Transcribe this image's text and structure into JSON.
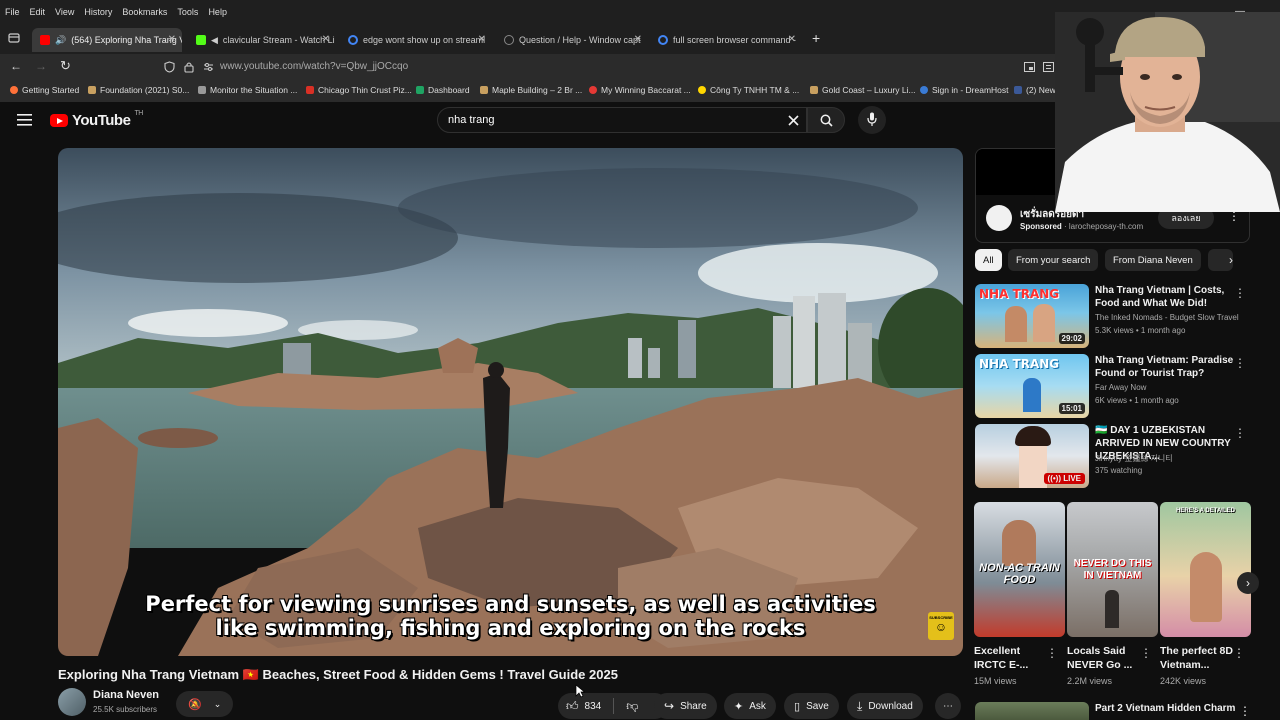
{
  "menubar": [
    "File",
    "Edit",
    "View",
    "History",
    "Bookmarks",
    "Tools",
    "Help"
  ],
  "tabs": [
    {
      "label": "(564) Exploring Nha Trang V",
      "color": "#ff0000"
    },
    {
      "label": "clavicular Stream - Watch Li",
      "color": "#53fc18"
    },
    {
      "label": "edge wont show up on streaml",
      "color": "#4285f4"
    },
    {
      "label": "Question / Help - Window capt",
      "color": "#888888"
    },
    {
      "label": "full screen browser command -",
      "color": "#4285f4"
    }
  ],
  "address": {
    "url": "www.youtube.com/watch?v=Qbw_jjOCcqo"
  },
  "bookmarks": [
    {
      "label": "Getting Started",
      "color": "#ff7139"
    },
    {
      "label": "Foundation (2021) S0...",
      "color": "#c8a060"
    },
    {
      "label": "Monitor the Situation ...",
      "color": "#999999"
    },
    {
      "label": "Chicago Thin Crust Piz...",
      "color": "#d93025"
    },
    {
      "label": "Dashboard",
      "color": "#1fa463"
    },
    {
      "label": "Maple Building – 2 Br ...",
      "color": "#c8a060"
    },
    {
      "label": "My Winning Baccarat ...",
      "color": "#e53935"
    },
    {
      "label": "Công Ty TNHH TM & ...",
      "color": "#ffd600"
    },
    {
      "label": "Gold Coast – Luxury Li...",
      "color": "#c8a060"
    },
    {
      "label": "Sign in - DreamHost",
      "color": "#3a7bd5"
    },
    {
      "label": "(2) New Message!",
      "color": "#3b5998"
    }
  ],
  "youtube": {
    "logo_text": "YouTube",
    "logo_region": "TH",
    "search_value": "nha trang"
  },
  "video": {
    "caption_line1": "Perfect for viewing sunrises and sunsets, as well as activities",
    "caption_line2": "like swimming, fishing and exploring on the rocks",
    "subscribe_badge": "SUBSCRIBE",
    "title": "Exploring Nha Trang Vietnam 🇻🇳 Beaches, Street Food & Hidden Gems ! Travel Guide 2025",
    "channel_name": "Diana Neven",
    "subscribers": "25.5K subscribers",
    "likes": "834",
    "share_label": "Share",
    "ask_label": "Ask",
    "save_label": "Save",
    "download_label": "Download"
  },
  "ad": {
    "title": "เซรั่มลดรอยดำ",
    "sponsored": "Sponsored",
    "domain": "larocheposay-th.com",
    "cta": "ลองเลย"
  },
  "chips": [
    "All",
    "From your search",
    "From Diana Neven"
  ],
  "recommendations": [
    {
      "title": "Nha Trang Vietnam | Costs, Food and What We Did!",
      "channel": "The Inked Nomads - Budget Slow Travel ...",
      "views": "5.3K views • 1 month ago",
      "duration": "29:02",
      "thumb_text": "NHA TRANG",
      "live": false
    },
    {
      "title": "Nha Trang Vietnam: Paradise Found or Tourist Trap?",
      "channel": "Far Away Now",
      "views": "6K views • 1 month ago",
      "duration": "15:01",
      "thumb_text": "NHA TRANG",
      "live": false
    },
    {
      "title": "🇺🇿 DAY 1 UZBEKISTAN ARRIVED IN NEW COUNTRY UZBEKISTA...",
      "channel": "Jinnytty 金鍾絲 지니티",
      "views": "375 watching",
      "duration": "LIVE",
      "thumb_text": "",
      "live": true
    }
  ],
  "shorts": [
    {
      "title": "Excellent IRCTC E-...",
      "views": "15M views",
      "thumb_text": "NON-AC TRAIN FOOD"
    },
    {
      "title": "Locals Said NEVER Go ...",
      "views": "2.2M views",
      "thumb_text": "NEVER DO THIS IN VIETNAM"
    },
    {
      "title": "The perfect 8D Vietnam...",
      "views": "242K views",
      "thumb_text": "HERE'S A DETAILED"
    }
  ],
  "next_rec": {
    "title": "Part 2 Vietnam Hidden Charm"
  }
}
